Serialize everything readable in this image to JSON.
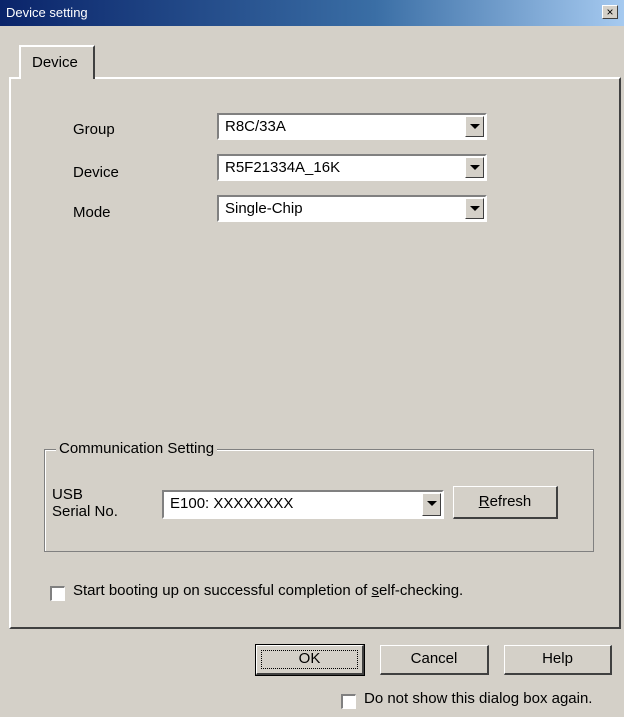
{
  "window": {
    "title": "Device setting",
    "close_glyph": "×"
  },
  "tabs": [
    {
      "label": "Device",
      "selected": true
    }
  ],
  "device": {
    "group": {
      "label": "Group",
      "value": "R8C/33A"
    },
    "device": {
      "label": "Device",
      "value": "R5F21334A_16K"
    },
    "mode": {
      "label": "Mode",
      "value": "Single-Chip"
    }
  },
  "communication": {
    "title": "Communication Setting",
    "usb_label_line1": "USB",
    "usb_label_line2": "Serial No.",
    "serial_value": "E100: XXXXXXXX",
    "refresh_label_first": "R",
    "refresh_label_rest": "efresh"
  },
  "boot_checkbox": {
    "label_before": "Start booting up on successful completion of ",
    "label_mnemonic": "s",
    "label_after": "elf-checking.",
    "checked": false
  },
  "buttons": {
    "ok": "OK",
    "cancel": "Cancel",
    "help": "Help"
  },
  "dont_show_checkbox": {
    "label": "Do not show this dialog box again.",
    "checked": false
  },
  "colors": {
    "face": "#d4d0c8",
    "title_start": "#0a246a",
    "title_end": "#a6caf0"
  }
}
